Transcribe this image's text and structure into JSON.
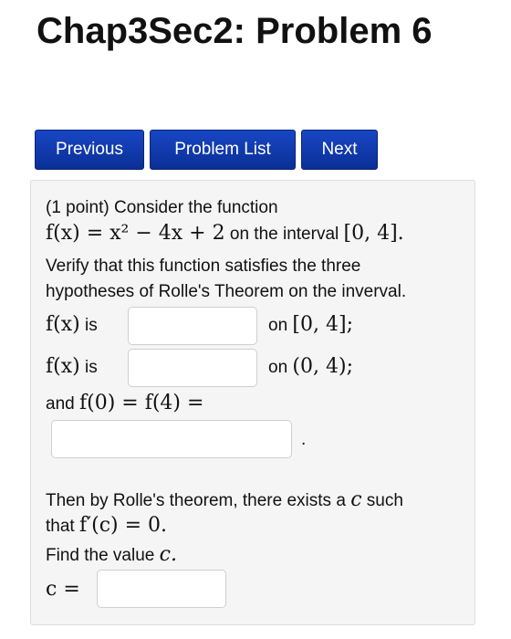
{
  "header": {
    "title": "Chap3Sec2: Problem 6"
  },
  "nav": {
    "previous_label": "Previous",
    "problem_list_label": "Problem List",
    "next_label": "Next"
  },
  "problem": {
    "intro": "(1 point) Consider the function",
    "function_expr": "f(x) = x² − 4x + 2",
    "interval_text": "on the interval",
    "interval": "[0, 4].",
    "verify_line1": "Verify that this function satisfies the three",
    "verify_line2": "hypotheses of Rolle's Theorem on the inverval.",
    "row1": {
      "fx": "f(x)",
      "is": "is",
      "on": "on",
      "interval": "[0, 4];",
      "value": ""
    },
    "row2": {
      "fx": "f(x)",
      "is": "is",
      "on": "on",
      "interval": "(0, 4);",
      "value": ""
    },
    "row3": {
      "and": "and",
      "expr": "f(0) = f(4) =",
      "value": "",
      "period": "."
    },
    "rolle_line1_text": "Then by Rolle's theorem, there exists a",
    "rolle_c": "c",
    "rolle_line1_end": "such",
    "rolle_line2_text": "that",
    "rolle_line2_expr": "f′(c) = 0.",
    "find_text": "Find the value",
    "find_c": "c.",
    "c_label": "c =",
    "c_value": ""
  },
  "colors": {
    "button_blue": "#0b35a8",
    "panel_bg": "#f5f5f5"
  }
}
